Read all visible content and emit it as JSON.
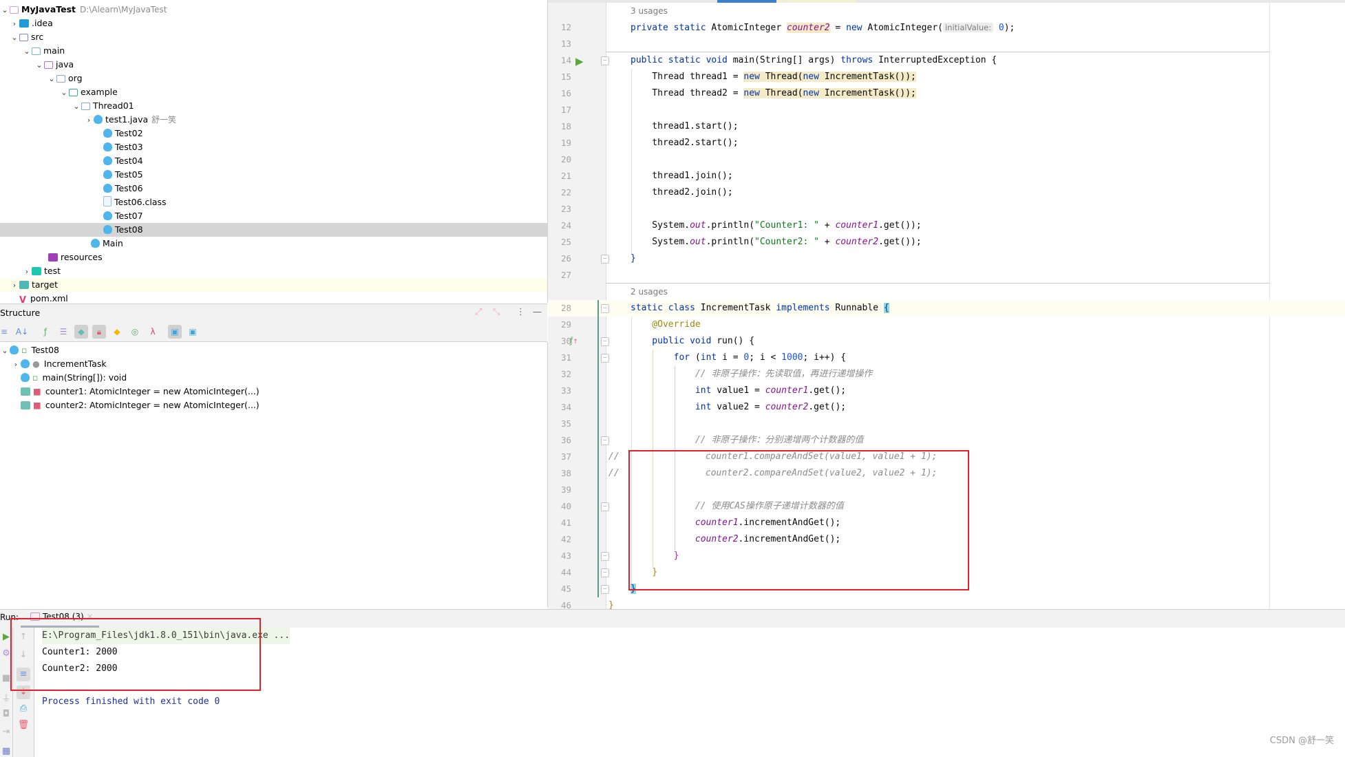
{
  "project_tree": {
    "root": {
      "label": "MyJavaTest",
      "path": "D:\\Alearn\\MyJavaTest"
    },
    "items": [
      {
        "label": ".idea",
        "icon": "idea-folder-icon",
        "expanded": false
      },
      {
        "label": "src",
        "icon": "source-folder-icon",
        "expanded": true
      },
      {
        "label": "main",
        "icon": "folder-icon",
        "expanded": true
      },
      {
        "label": "java",
        "icon": "source-root-folder-icon",
        "expanded": true
      },
      {
        "label": "org",
        "icon": "package-icon",
        "expanded": true
      },
      {
        "label": "example",
        "icon": "package-icon",
        "expanded": true
      },
      {
        "label": "Thread01",
        "icon": "package-icon",
        "expanded": true
      },
      {
        "label": "test1.java",
        "icon": "java-class-icon",
        "expanded": false,
        "author": "舒一笑"
      },
      {
        "label": "Test02",
        "icon": "java-class-icon"
      },
      {
        "label": "Test03",
        "icon": "java-class-icon"
      },
      {
        "label": "Test04",
        "icon": "java-class-icon"
      },
      {
        "label": "Test05",
        "icon": "java-class-icon"
      },
      {
        "label": "Test06",
        "icon": "java-class-icon"
      },
      {
        "label": "Test06.class",
        "icon": "class-file-icon"
      },
      {
        "label": "Test07",
        "icon": "java-class-icon"
      },
      {
        "label": "Test08",
        "icon": "java-class-icon",
        "selected": true
      },
      {
        "label": "Main",
        "icon": "java-class-icon"
      },
      {
        "label": "resources",
        "icon": "resources-folder-icon"
      },
      {
        "label": "test",
        "icon": "test-folder-icon",
        "expanded": false
      },
      {
        "label": "target",
        "icon": "excluded-folder-icon",
        "expanded": false
      },
      {
        "label": "pom.xml",
        "icon": "maven-icon"
      }
    ]
  },
  "structure": {
    "title": "Structure",
    "items": [
      {
        "label": "Test08"
      },
      {
        "label": "IncrementTask"
      },
      {
        "label": "main(String[]): void"
      },
      {
        "label": "counter1: AtomicInteger = new AtomicInteger(...)"
      },
      {
        "label": "counter2: AtomicInteger = new AtomicInteger(...)"
      }
    ]
  },
  "editor": {
    "usages_top": "3 usages",
    "usages_class": "2 usages",
    "inlay_hint": "initialValue:",
    "lines": [
      {
        "n": "12"
      },
      {
        "n": "13"
      },
      {
        "n": "14"
      },
      {
        "n": "15"
      },
      {
        "n": "16"
      },
      {
        "n": "17"
      },
      {
        "n": "18"
      },
      {
        "n": "19"
      },
      {
        "n": "20"
      },
      {
        "n": "21"
      },
      {
        "n": "22"
      },
      {
        "n": "23"
      },
      {
        "n": "24"
      },
      {
        "n": "25"
      },
      {
        "n": "26"
      },
      {
        "n": "27"
      },
      {
        "n": "28"
      },
      {
        "n": "29"
      },
      {
        "n": "30"
      },
      {
        "n": "31"
      },
      {
        "n": "32"
      },
      {
        "n": "33"
      },
      {
        "n": "34"
      },
      {
        "n": "35"
      },
      {
        "n": "36"
      },
      {
        "n": "37"
      },
      {
        "n": "38"
      },
      {
        "n": "39"
      },
      {
        "n": "40"
      },
      {
        "n": "41"
      },
      {
        "n": "42"
      },
      {
        "n": "43"
      },
      {
        "n": "44"
      },
      {
        "n": "45"
      },
      {
        "n": "46"
      }
    ],
    "code": {
      "l12a": "private static ",
      "l12b": "AtomicInteger ",
      "l12c": "counter2",
      "l12d": " = ",
      "l12e": "new ",
      "l12f": "AtomicInteger(",
      "l12g": "0",
      "l12h": ");",
      "l14a": "public static void ",
      "l14b": "main(String[] args) ",
      "l14c": "throws ",
      "l14d": "InterruptedException {",
      "l15a": "    Thread thread1 = ",
      "l15b": "new ",
      "l15c": "Thread(",
      "l15d": "new ",
      "l15e": "IncrementTask());",
      "l16a": "    Thread thread2 = ",
      "l16b": "new ",
      "l16c": "Thread(",
      "l16d": "new ",
      "l16e": "IncrementTask());",
      "l18": "    thread1.start();",
      "l19": "    thread2.start();",
      "l21": "    thread1.join();",
      "l22": "    thread2.join();",
      "l24a": "    System.",
      "l24b": "out",
      "l24c": ".println(",
      "l24d": "\"Counter1: \"",
      "l24e": " + ",
      "l24f": "counter1",
      "l24g": ".get());",
      "l25a": "    System.",
      "l25b": "out",
      "l25c": ".println(",
      "l25d": "\"Counter2: \"",
      "l25e": " + ",
      "l25f": "counter2",
      "l25g": ".get());",
      "l26": "}",
      "l28a": "static class ",
      "l28b": "IncrementTask ",
      "l28c": "implements ",
      "l28d": "Runnable ",
      "l28e": "{",
      "l29": "    @Override",
      "l30a": "    public void ",
      "l30b": "run() {",
      "l31a": "        for ",
      "l31b": "(",
      "l31c": "int ",
      "l31d": "i = ",
      "l31e": "0",
      "l31f": "; i < ",
      "l31g": "1000",
      "l31h": "; i++) {",
      "l32": "            // 非原子操作：先读取值，再进行递增操作",
      "l33a": "            int ",
      "l33b": "value1 = ",
      "l33c": "counter1",
      "l33d": ".get();",
      "l34a": "            int ",
      "l34b": "value2 = ",
      "l34c": "counter2",
      "l34d": ".get();",
      "l36": "            // 非原子操作：分别递增两个计数器的值",
      "l37": "//                counter1.compareAndSet(value1, value1 + 1);",
      "l38": "//                counter2.compareAndSet(value2, value2 + 1);",
      "l40": "            // 使用CAS操作原子递增计数器的值",
      "l41a": "            ",
      "l41b": "counter1",
      "l41c": ".incrementAndGet();",
      "l42a": "            ",
      "l42b": "counter2",
      "l42c": ".incrementAndGet();",
      "l43": "        }",
      "l44": "    }",
      "l45": "}",
      "l46": "}"
    }
  },
  "run": {
    "label": "Run:",
    "tab": "Test08 (3)",
    "output": [
      "E:\\Program_Files\\jdk1.8.0_151\\bin\\java.exe ...",
      "Counter1: 2000",
      "Counter2: 2000",
      "",
      "Process finished with exit code 0"
    ]
  },
  "watermark": "CSDN @舒一笑",
  "colors": {
    "annotation_box": "#e3202a",
    "keyword": "#0033b3",
    "field": "#871094",
    "string": "#067d17",
    "comment": "#8c8c8c"
  }
}
